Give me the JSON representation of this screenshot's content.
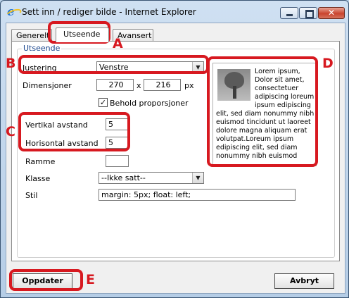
{
  "window": {
    "title": "Sett inn / rediger bilde - Internet Explorer",
    "icon": "internet-explorer-icon",
    "controls": {
      "minimize": "minimize-icon",
      "maximize": "maximize-icon",
      "close": "✕"
    }
  },
  "tabs": [
    {
      "label": "Generelt",
      "active": false
    },
    {
      "label": "Utseende",
      "active": true
    },
    {
      "label": "Avansert",
      "active": false
    }
  ],
  "section": {
    "legend": "Utseende"
  },
  "form": {
    "alignment": {
      "label": "Justering",
      "value": "Venstre"
    },
    "dimensions": {
      "label": "Dimensjoner",
      "width": "270",
      "separator": "x",
      "height": "216",
      "unit": "px"
    },
    "keep_proportions": {
      "label": "Behold proporsjoner",
      "checked": true,
      "mark": "✓"
    },
    "vertical_spacing": {
      "label": "Vertikal avstand",
      "value": "5"
    },
    "horizontal_spacing": {
      "label": "Horisontal avstand",
      "value": "5"
    },
    "border": {
      "label": "Ramme",
      "value": ""
    },
    "class": {
      "label": "Klasse",
      "value": "--Ikke satt--"
    },
    "style": {
      "label": "Stil",
      "value": "margin: 5px; float: left;"
    }
  },
  "preview": {
    "text": "Lorem ipsum, Dolor sit amet, consectetuer adipiscing loreum ipsum edipiscing elit, sed diam nonummy nibh euismod tincidunt ut laoreet dolore magna aliquam erat volutpat.Loreum ipsum edipiscing elit, sed diam nonummy nibh euismod"
  },
  "buttons": {
    "update": "Oppdater",
    "cancel": "Avbryt"
  },
  "annotations": {
    "a": "A",
    "b": "B",
    "c": "C",
    "d": "D",
    "e": "E",
    "color": "#d71920"
  }
}
